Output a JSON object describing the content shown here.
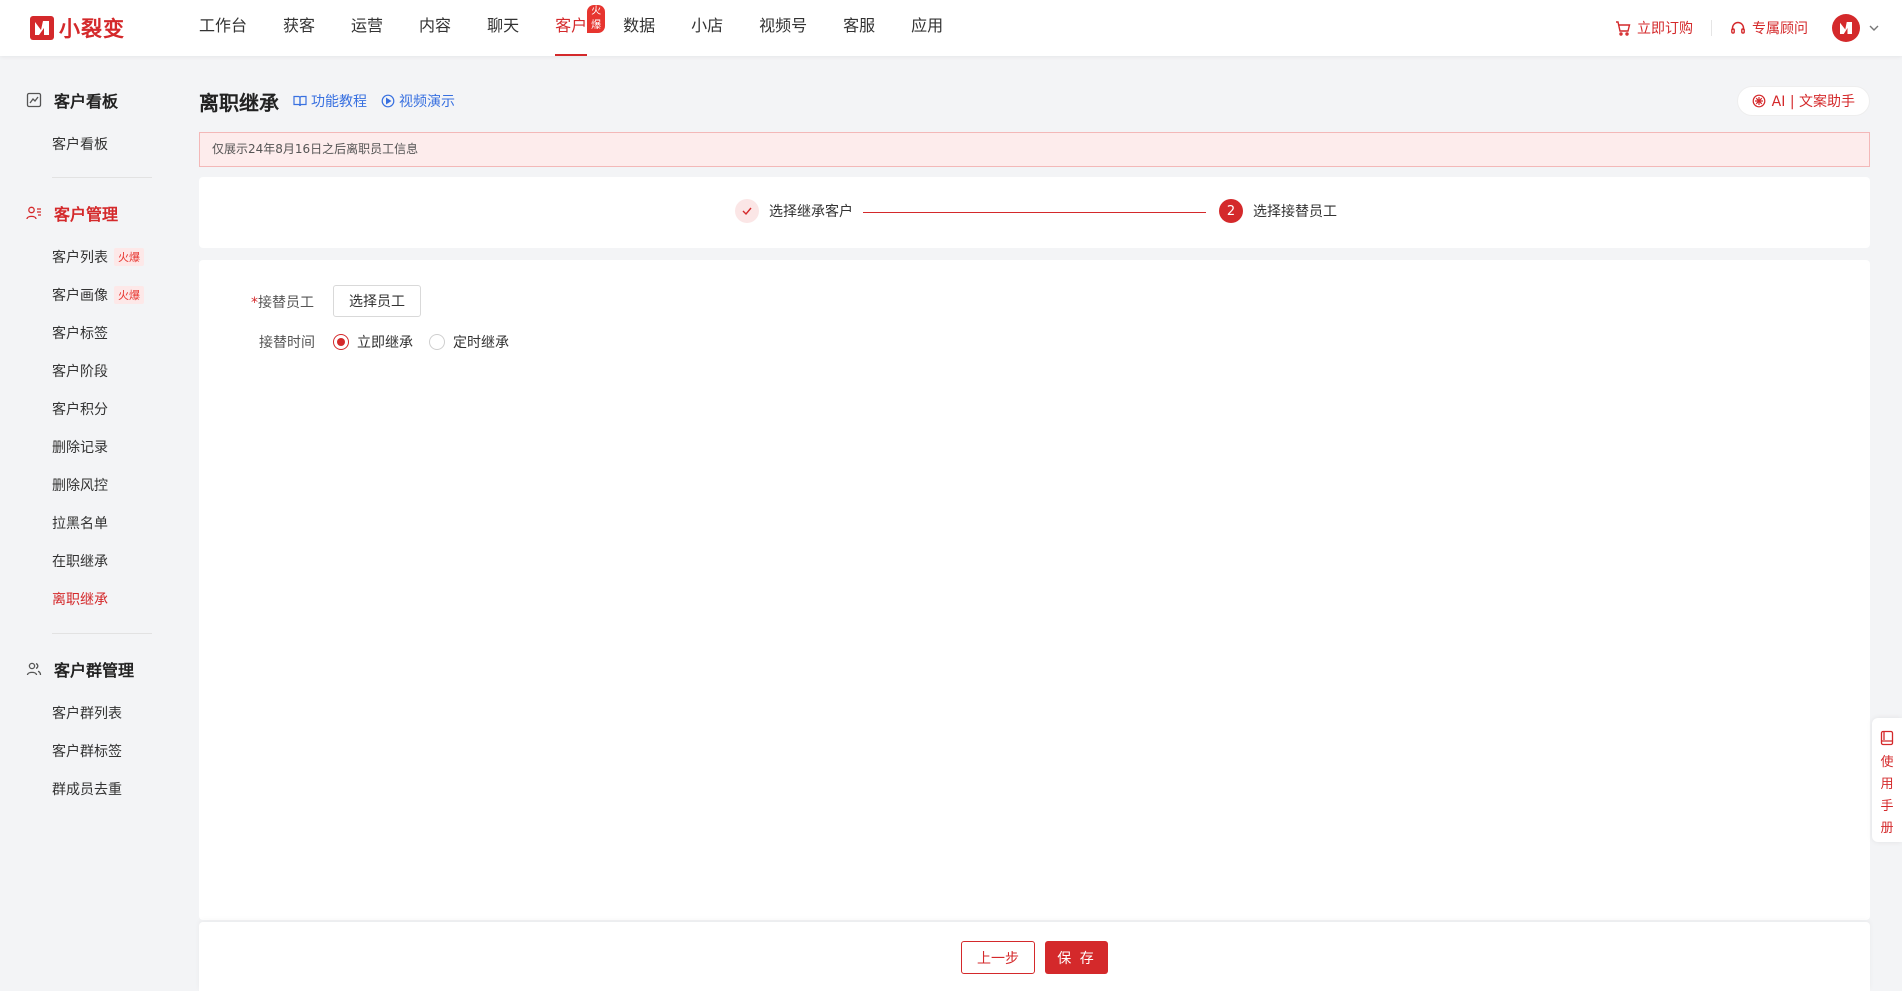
{
  "brand": {
    "name": "小裂变",
    "color": "#d4292b"
  },
  "nav": {
    "items": [
      {
        "label": "工作台"
      },
      {
        "label": "获客"
      },
      {
        "label": "运营"
      },
      {
        "label": "内容"
      },
      {
        "label": "聊天"
      },
      {
        "label": "客户",
        "badge": "火爆",
        "active": true
      },
      {
        "label": "数据"
      },
      {
        "label": "小店"
      },
      {
        "label": "视频号"
      },
      {
        "label": "客服"
      },
      {
        "label": "应用"
      }
    ]
  },
  "topbar": {
    "order_label": "立即订购",
    "consultant_label": "专属顾问"
  },
  "sidebar": {
    "groups": [
      {
        "title": "客户看板",
        "icon": "chart-board-icon",
        "items": [
          {
            "label": "客户看板"
          }
        ]
      },
      {
        "title": "客户管理",
        "icon": "user-list-icon",
        "active": true,
        "items": [
          {
            "label": "客户列表",
            "badge": "火爆"
          },
          {
            "label": "客户画像",
            "badge": "火爆"
          },
          {
            "label": "客户标签"
          },
          {
            "label": "客户阶段"
          },
          {
            "label": "客户积分"
          },
          {
            "label": "删除记录"
          },
          {
            "label": "删除风控"
          },
          {
            "label": "拉黑名单"
          },
          {
            "label": "在职继承"
          },
          {
            "label": "离职继承",
            "active": true
          }
        ]
      },
      {
        "title": "客户群管理",
        "icon": "group-icon",
        "items": [
          {
            "label": "客户群列表"
          },
          {
            "label": "客户群标签"
          },
          {
            "label": "群成员去重"
          }
        ]
      }
    ]
  },
  "page": {
    "title": "离职继承",
    "tutorial_label": "功能教程",
    "video_label": "视频演示",
    "ai_label": "AI | 文案助手",
    "notice": "仅展示24年8月16日之后离职员工信息"
  },
  "steps": [
    {
      "label": "选择继承客户",
      "status": "done"
    },
    {
      "label": "选择接替员工",
      "number": "2",
      "status": "current"
    }
  ],
  "form": {
    "replace_staff_label": "接替员工",
    "required_mark": "*",
    "select_staff_button": "选择员工",
    "replace_time_label": "接替时间",
    "options": [
      {
        "label": "立即继承",
        "checked": true
      },
      {
        "label": "定时继承",
        "checked": false
      }
    ]
  },
  "footer": {
    "prev_label": "上一步",
    "save_label": "保 存"
  },
  "manual": {
    "label": "使用手册"
  }
}
